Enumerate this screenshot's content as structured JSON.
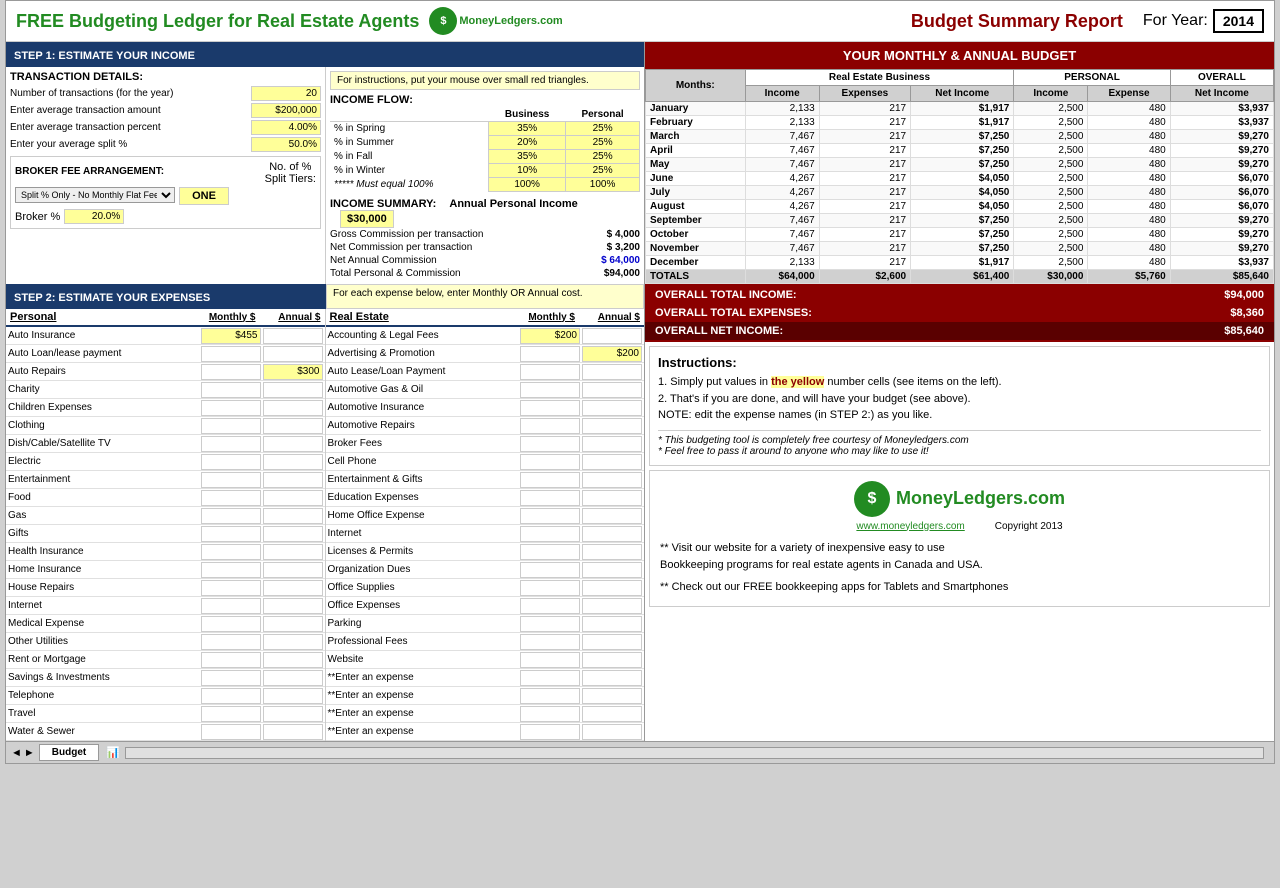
{
  "header": {
    "title": "FREE Budgeting Ledger for Real Estate Agents",
    "logo_symbol": "$",
    "logo_text": "MoneyLedgers.com",
    "budget_summary_title": "Budget Summary Report",
    "for_year_label": "For Year:",
    "year": "2014"
  },
  "step1": {
    "section_label": "STEP 1:  ESTIMATE YOUR INCOME",
    "instructions": "For instructions, put your mouse over small red triangles.",
    "transaction_details": {
      "header": "TRANSACTION DETAILS:",
      "fields": [
        {
          "label": "Number of transactions (for the year)",
          "value": "20"
        },
        {
          "label": "Enter average transaction amount",
          "value": "$200,000"
        },
        {
          "label": "Enter average transaction percent",
          "value": "4.00%"
        },
        {
          "label": "Enter your average split %",
          "value": "50.0%"
        }
      ]
    },
    "broker_fee": {
      "header": "BROKER FEE ARRANGEMENT:",
      "no_of_label": "No. of %",
      "split_tiers_label": "Split Tiers:",
      "dropdown_value": "Split % Only - No Monthly Flat Fee",
      "one_label": "ONE",
      "broker_percent_label": "Broker %",
      "broker_percent_value": "20.0%"
    },
    "income_flow": {
      "header": "INCOME FLOW:",
      "col_business": "Business",
      "col_personal": "Personal",
      "rows": [
        {
          "label": "% in Spring",
          "business": "35%",
          "personal": "25%"
        },
        {
          "label": "% in Summer",
          "business": "20%",
          "personal": "25%"
        },
        {
          "label": "% in Fall",
          "business": "35%",
          "personal": "25%"
        },
        {
          "label": "% in Winter",
          "business": "10%",
          "personal": "25%"
        },
        {
          "label": "***** Must equal 100%",
          "business": "100%",
          "personal": "100%"
        }
      ]
    },
    "income_summary": {
      "header": "INCOME SUMMARY:",
      "annual_personal_label": "Annual Personal Income",
      "annual_personal_value": "$30,000",
      "rows": [
        {
          "label": "Gross Commission per transaction",
          "prefix": "$",
          "value": "4,000"
        },
        {
          "label": "Net Commission per transaction",
          "prefix": "$",
          "value": "3,200"
        },
        {
          "label": "Net Annual Commission",
          "prefix": "$",
          "value": "64,000",
          "bold": true
        },
        {
          "label": "Total Personal & Commission",
          "prefix": "",
          "value": "$94,000"
        }
      ]
    }
  },
  "step2": {
    "section_label": "STEP 2: ESTIMATE YOUR EXPENSES",
    "instructions": "For each expense below, enter Monthly OR Annual cost.",
    "personal_col": {
      "header": "Personal",
      "monthly_header": "Monthly $",
      "annual_header": "Annual $",
      "items": [
        {
          "name": "Auto Insurance",
          "monthly": "$455",
          "annual": ""
        },
        {
          "name": "Auto Loan/lease payment",
          "monthly": "",
          "annual": ""
        },
        {
          "name": "Auto Repairs",
          "monthly": "",
          "annual": "$300"
        },
        {
          "name": "Charity",
          "monthly": "",
          "annual": ""
        },
        {
          "name": "Children Expenses",
          "monthly": "",
          "annual": ""
        },
        {
          "name": "Clothing",
          "monthly": "",
          "annual": ""
        },
        {
          "name": "Dish/Cable/Satellite TV",
          "monthly": "",
          "annual": ""
        },
        {
          "name": "Electric",
          "monthly": "",
          "annual": ""
        },
        {
          "name": "Entertainment",
          "monthly": "",
          "annual": ""
        },
        {
          "name": "Food",
          "monthly": "",
          "annual": ""
        },
        {
          "name": "Gas",
          "monthly": "",
          "annual": ""
        },
        {
          "name": "Gifts",
          "monthly": "",
          "annual": ""
        },
        {
          "name": "Health Insurance",
          "monthly": "",
          "annual": ""
        },
        {
          "name": "Home Insurance",
          "monthly": "",
          "annual": ""
        },
        {
          "name": "House Repairs",
          "monthly": "",
          "annual": ""
        },
        {
          "name": "Internet",
          "monthly": "",
          "annual": ""
        },
        {
          "name": "Medical Expense",
          "monthly": "",
          "annual": ""
        },
        {
          "name": "Other Utilities",
          "monthly": "",
          "annual": ""
        },
        {
          "name": "Rent or Mortgage",
          "monthly": "",
          "annual": ""
        },
        {
          "name": "Savings & Investments",
          "monthly": "",
          "annual": ""
        },
        {
          "name": "Telephone",
          "monthly": "",
          "annual": ""
        },
        {
          "name": "Travel",
          "monthly": "",
          "annual": ""
        },
        {
          "name": "Water & Sewer",
          "monthly": "",
          "annual": ""
        }
      ]
    },
    "real_estate_col": {
      "header": "Real Estate",
      "monthly_header": "Monthly $",
      "annual_header": "Annual $",
      "items": [
        {
          "name": "Accounting & Legal Fees",
          "monthly": "$200",
          "annual": ""
        },
        {
          "name": "Advertising & Promotion",
          "monthly": "",
          "annual": "$200"
        },
        {
          "name": "Auto Lease/Loan Payment",
          "monthly": "",
          "annual": ""
        },
        {
          "name": "Automotive Gas & Oil",
          "monthly": "",
          "annual": ""
        },
        {
          "name": "Automotive Insurance",
          "monthly": "",
          "annual": ""
        },
        {
          "name": "Automotive Repairs",
          "monthly": "",
          "annual": ""
        },
        {
          "name": "Broker Fees",
          "monthly": "",
          "annual": ""
        },
        {
          "name": "Cell Phone",
          "monthly": "",
          "annual": ""
        },
        {
          "name": "Entertainment & Gifts",
          "monthly": "",
          "annual": ""
        },
        {
          "name": "Education Expenses",
          "monthly": "",
          "annual": ""
        },
        {
          "name": "Home Office Expense",
          "monthly": "",
          "annual": ""
        },
        {
          "name": "Internet",
          "monthly": "",
          "annual": ""
        },
        {
          "name": "Licenses & Permits",
          "monthly": "",
          "annual": ""
        },
        {
          "name": "Organization Dues",
          "monthly": "",
          "annual": ""
        },
        {
          "name": "Office Supplies",
          "monthly": "",
          "annual": ""
        },
        {
          "name": "Office Expenses",
          "monthly": "",
          "annual": ""
        },
        {
          "name": "Parking",
          "monthly": "",
          "annual": ""
        },
        {
          "name": "Professional Fees",
          "monthly": "",
          "annual": ""
        },
        {
          "name": "Website",
          "monthly": "",
          "annual": ""
        },
        {
          "name": "**Enter an expense",
          "monthly": "",
          "annual": ""
        },
        {
          "name": "**Enter an expense",
          "monthly": "",
          "annual": ""
        },
        {
          "name": "**Enter an expense",
          "monthly": "",
          "annual": ""
        },
        {
          "name": "**Enter an expense",
          "monthly": "",
          "annual": ""
        }
      ]
    }
  },
  "budget_table": {
    "header": "YOUR MONTHLY & ANNUAL BUDGET",
    "col_groups": [
      {
        "label": "Real Estate Business",
        "cols": [
          "Income",
          "Expenses",
          "Net Income"
        ]
      },
      {
        "label": "PERSONAL",
        "cols": [
          "Income",
          "Expense"
        ]
      },
      {
        "label": "OVERALL",
        "cols": [
          "Net Income"
        ]
      }
    ],
    "months_label": "Months:",
    "rows": [
      {
        "month": "January",
        "re_income": "2,133",
        "re_expenses": "217",
        "re_net": "$1,917",
        "p_income": "2,500",
        "p_expense": "480",
        "overall_net": "$3,937"
      },
      {
        "month": "February",
        "re_income": "2,133",
        "re_expenses": "217",
        "re_net": "$1,917",
        "p_income": "2,500",
        "p_expense": "480",
        "overall_net": "$3,937"
      },
      {
        "month": "March",
        "re_income": "7,467",
        "re_expenses": "217",
        "re_net": "$7,250",
        "p_income": "2,500",
        "p_expense": "480",
        "overall_net": "$9,270"
      },
      {
        "month": "April",
        "re_income": "7,467",
        "re_expenses": "217",
        "re_net": "$7,250",
        "p_income": "2,500",
        "p_expense": "480",
        "overall_net": "$9,270"
      },
      {
        "month": "May",
        "re_income": "7,467",
        "re_expenses": "217",
        "re_net": "$7,250",
        "p_income": "2,500",
        "p_expense": "480",
        "overall_net": "$9,270"
      },
      {
        "month": "June",
        "re_income": "4,267",
        "re_expenses": "217",
        "re_net": "$4,050",
        "p_income": "2,500",
        "p_expense": "480",
        "overall_net": "$6,070"
      },
      {
        "month": "July",
        "re_income": "4,267",
        "re_expenses": "217",
        "re_net": "$4,050",
        "p_income": "2,500",
        "p_expense": "480",
        "overall_net": "$6,070"
      },
      {
        "month": "August",
        "re_income": "4,267",
        "re_expenses": "217",
        "re_net": "$4,050",
        "p_income": "2,500",
        "p_expense": "480",
        "overall_net": "$6,070"
      },
      {
        "month": "September",
        "re_income": "7,467",
        "re_expenses": "217",
        "re_net": "$7,250",
        "p_income": "2,500",
        "p_expense": "480",
        "overall_net": "$9,270"
      },
      {
        "month": "October",
        "re_income": "7,467",
        "re_expenses": "217",
        "re_net": "$7,250",
        "p_income": "2,500",
        "p_expense": "480",
        "overall_net": "$9,270"
      },
      {
        "month": "November",
        "re_income": "7,467",
        "re_expenses": "217",
        "re_net": "$7,250",
        "p_income": "2,500",
        "p_expense": "480",
        "overall_net": "$9,270"
      },
      {
        "month": "December",
        "re_income": "2,133",
        "re_expenses": "217",
        "re_net": "$1,917",
        "p_income": "2,500",
        "p_expense": "480",
        "overall_net": "$3,937"
      }
    ],
    "totals": {
      "label": "TOTALS",
      "re_income": "$64,000",
      "re_expenses": "$2,600",
      "re_net": "$61,400",
      "p_income": "$30,000",
      "p_expense": "$5,760",
      "overall_net": "$85,640"
    }
  },
  "overall_totals": {
    "income_label": "OVERALL TOTAL INCOME:",
    "income_value": "$94,000",
    "expenses_label": "OVERALL TOTAL EXPENSES:",
    "expenses_value": "$8,360",
    "net_label": "OVERALL NET INCOME:",
    "net_value": "$85,640"
  },
  "instructions": {
    "title": "Instructions:",
    "line1": "1. Simply put values in the yellow number cells (see items on the left).",
    "line2": "2. That's if you are done, and will have your budget (see above).",
    "note": "NOTE: edit the expense names (in STEP 2:) as you like.",
    "disclaimer1": "* This budgeting tool is completely free courtesy of Moneyledgers.com",
    "disclaimer2": "* Feel free to pass it around to anyone who may like to use it!"
  },
  "logo_section": {
    "icon_symbol": "$",
    "name": "MoneyLedgers.com",
    "url": "www.moneyledgers.com",
    "copyright": "Copyright 2013",
    "desc1": "** Visit our website for a variety of inexpensive easy to use",
    "desc2": "Bookkeeping programs for real estate agents in Canada and USA.",
    "desc3": "** Check out our FREE bookkeeping apps for Tablets and Smartphones"
  },
  "bottom_bar": {
    "tab_label": "Budget",
    "nav_prev": "◄",
    "nav_next": "►"
  }
}
